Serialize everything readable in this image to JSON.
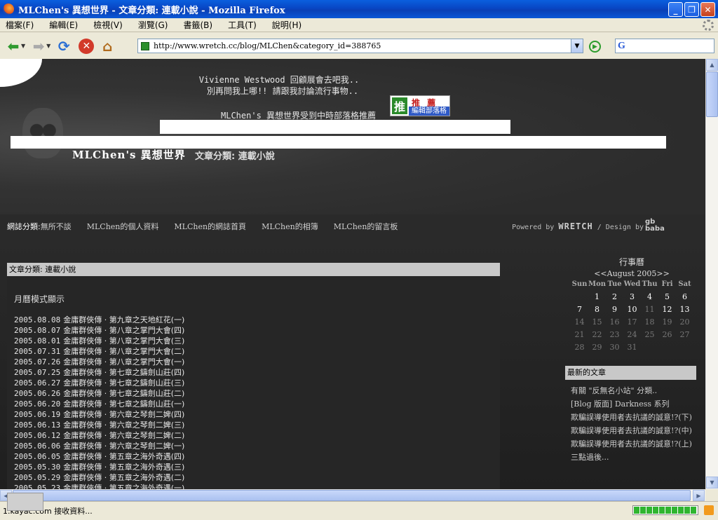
{
  "window": {
    "title": "MLChen's 異想世界 - 文章分類: 連載小說 - Mozilla Firefox"
  },
  "menu": [
    "檔案(F)",
    "編輯(E)",
    "檢視(V)",
    "瀏覽(G)",
    "書籤(B)",
    "工具(T)",
    "說明(H)"
  ],
  "toolbar": {
    "url": "http://www.wretch.cc/blog/MLChen&category_id=388765",
    "search_engine": "G"
  },
  "page": {
    "header_line1": "Vivienne Westwood 回顧展會去吧我..",
    "header_line2": "別再問我上哪!! 請跟我討論流行事物..",
    "header_line3": "MLChen's 異想世界受到中時部落格推薦",
    "award_top": "推 薦",
    "award_bottom": "編輯部落格",
    "award_mark": "推",
    "site_title": "MLChen's 異想世界",
    "category_heading": "文章分類: 連載小說",
    "nav_label": "網誌分類:",
    "nav_links": [
      "無所不談",
      "MLChen的個人資料",
      "MLChen的網誌首頁",
      "MLChen的相簿",
      "MLChen的留言板"
    ],
    "powered_by": "Powered by",
    "wretch": "WRETCH",
    "design_by": "/ Design by",
    "gb": "gb\nbaba"
  },
  "posts_panel": {
    "heading": "文章分類: 連載小說",
    "calendar_mode": "月曆模式顯示",
    "posts": [
      {
        "date": "2005.08.08",
        "title": "金庸群俠傳 · 第九章之天地紅花(一)"
      },
      {
        "date": "2005.08.07",
        "title": "金庸群俠傳 · 第八章之掌門大會(四)"
      },
      {
        "date": "2005.08.01",
        "title": "金庸群俠傳 · 第八章之掌門大會(三)"
      },
      {
        "date": "2005.07.31",
        "title": "金庸群俠傳 · 第八章之掌門大會(二)"
      },
      {
        "date": "2005.07.26",
        "title": "金庸群俠傳 · 第八章之掌門大會(一)"
      },
      {
        "date": "2005.07.25",
        "title": "金庸群俠傳 · 第七章之鑄劍山莊(四)"
      },
      {
        "date": "2005.06.27",
        "title": "金庸群俠傳 · 第七章之鑄劍山莊(三)"
      },
      {
        "date": "2005.06.26",
        "title": "金庸群俠傳 · 第七章之鑄劍山莊(二)"
      },
      {
        "date": "2005.06.20",
        "title": "金庸群俠傳 · 第七章之鑄劍山莊(一)"
      },
      {
        "date": "2005.06.19",
        "title": "金庸群俠傳 · 第六章之琴劍二婢(四)"
      },
      {
        "date": "2005.06.13",
        "title": "金庸群俠傳 · 第六章之琴劍二婢(三)"
      },
      {
        "date": "2005.06.12",
        "title": "金庸群俠傳 · 第六章之琴劍二婢(二)"
      },
      {
        "date": "2005.06.06",
        "title": "金庸群俠傳 · 第六章之琴劍二婢(一)"
      },
      {
        "date": "2005.06.05",
        "title": "金庸群俠傳 · 第五章之海外奇遇(四)"
      },
      {
        "date": "2005.05.30",
        "title": "金庸群俠傳 · 第五章之海外奇遇(三)"
      },
      {
        "date": "2005.05.29",
        "title": "金庸群俠傳 · 第五章之海外奇遇(二)"
      },
      {
        "date": "2005.05.23",
        "title": "金庸群俠傳 · 第五章之海外奇遇(一)"
      }
    ]
  },
  "calendar": {
    "title": "行事曆",
    "nav": "<<August 2005>>",
    "weekdays": [
      "Sun",
      "Mon",
      "Tue",
      "Wed",
      "Thu",
      "Fri",
      "Sat"
    ],
    "weeks": [
      [
        "",
        "1",
        "2",
        "3",
        "4",
        "5",
        "6"
      ],
      [
        "7",
        "8",
        "9",
        "10",
        "11",
        "12",
        "13"
      ],
      [
        "14",
        "15",
        "16",
        "17",
        "18",
        "19",
        "20"
      ],
      [
        "21",
        "22",
        "23",
        "24",
        "25",
        "26",
        "27"
      ],
      [
        "28",
        "29",
        "30",
        "31",
        "",
        "",
        ""
      ]
    ],
    "post_days": [
      "1",
      "4",
      "7",
      "8"
    ]
  },
  "newest": {
    "heading": "最新的文章",
    "items": [
      "有關 \"反無名小站\" 分類..",
      "[Blog 版面] Darkness 系列",
      "欺騙誤導使用者去抗議的誠意!?(下)",
      "欺騙誤導使用者去抗議的誠意!?(中)",
      "欺騙誤導使用者去抗議的誠意!?(上)",
      "三點過後..."
    ]
  },
  "status": {
    "text": "1.kayac.com 接收資料...",
    "progress_segments": 10
  },
  "colors": {
    "titlebar": "#0a46c4",
    "page_bg": "#262626",
    "panel_head": "#c8c8c8",
    "progress": "#2fb52f"
  }
}
